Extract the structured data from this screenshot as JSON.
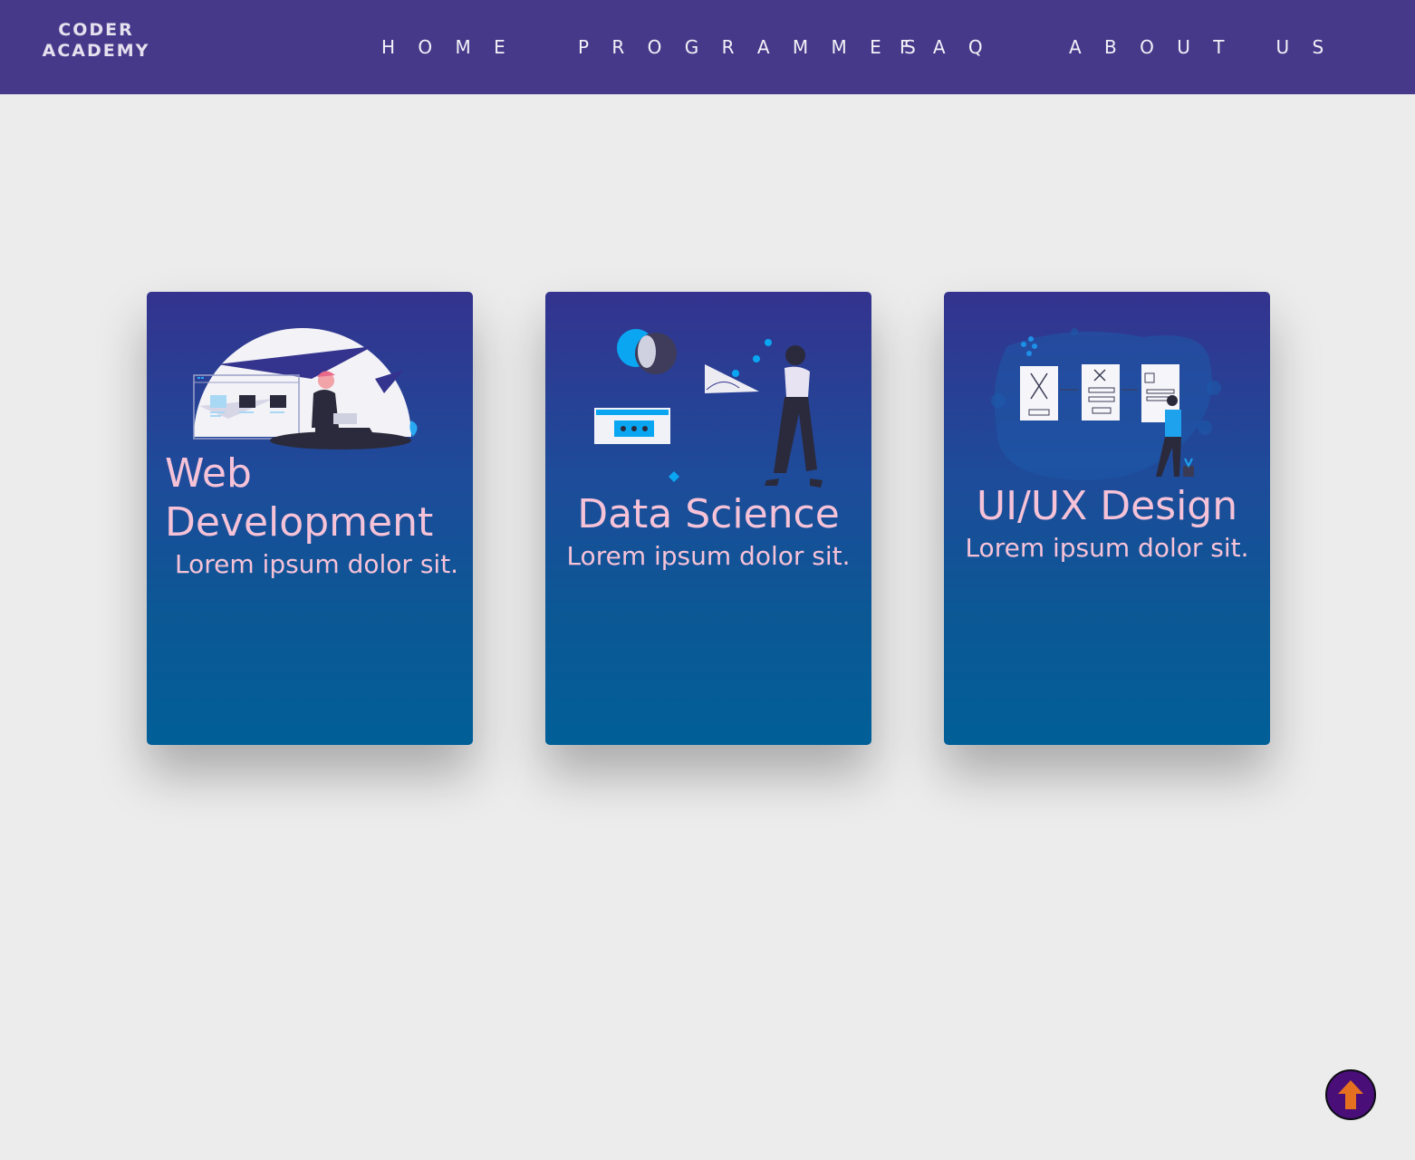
{
  "brand": {
    "line1": "CODER",
    "line2": "ACADEMY"
  },
  "nav": {
    "home": "H O M E",
    "programmes": "P R O G R A M M E S",
    "faq": "F A Q",
    "about": "A B O U T   U S"
  },
  "cards": [
    {
      "title_line1": "Web",
      "title_line2": "Development",
      "text": "Lorem ipsum dolor sit.",
      "illustration": "person-with-laptop-illustration"
    },
    {
      "title": "Data Science",
      "text": "Lorem ipsum dolor sit.",
      "illustration": "data-charts-illustration"
    },
    {
      "title": "UI/UX Design",
      "text": "Lorem ipsum dolor sit.",
      "illustration": "wireframe-board-illustration"
    }
  ],
  "scroll_top": {
    "icon": "up-arrow-icon"
  },
  "colors": {
    "navbar": "#47398a",
    "card_top": "#34338e",
    "card_bottom": "#015f97",
    "card_text": "#f6c2d8",
    "scroll_button": "#4a0e78",
    "scroll_arrow": "#e5701f"
  }
}
